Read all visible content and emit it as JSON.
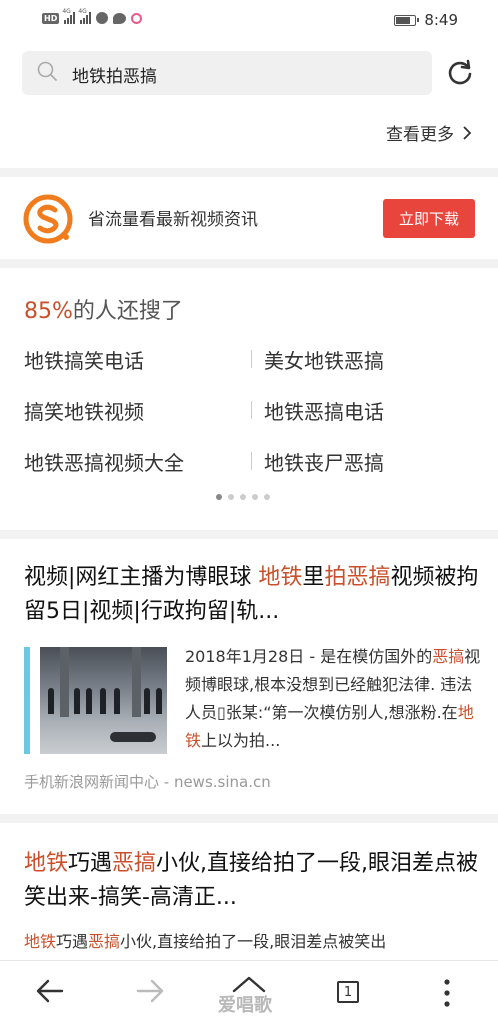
{
  "status_bar": {
    "network_badge": "HD",
    "signal1_type": "4G",
    "signal2_type": "4G",
    "time": "8:49"
  },
  "search": {
    "query": "地铁拍恶搞",
    "more_label": "查看更多"
  },
  "banner": {
    "text": "省流量看最新视频资讯",
    "button_label": "立即下载",
    "brand_color": "#f07c1e",
    "button_color": "#e8463c"
  },
  "related": {
    "title_percent": "85%",
    "title_rest": "的人还搜了",
    "items": [
      "地铁搞笑电话",
      "美女地铁恶搞",
      "搞笑地铁视频",
      "地铁恶搞电话",
      "地铁恶搞视频大全",
      "地铁丧尸恶搞"
    ],
    "page_count": 5,
    "active_page": 1
  },
  "results": [
    {
      "title_part1": "视频|网红主播为博眼球 ",
      "title_hl1": "地铁",
      "title_part2": "里",
      "title_hl2": "拍恶搞",
      "title_part3": "视频被拘留5日|视频|行政拘留|轨...",
      "snippet_part1": "2018年1月28日 - 是在模仿国外的",
      "snippet_hl1": "恶搞",
      "snippet_part2": "视频博眼球,根本没想到已经触犯法律. 违法人员",
      "snippet_glyph": "▯",
      "snippet_part3": "张某:“第一次模仿别人,想涨粉.在",
      "snippet_hl2": "地铁",
      "snippet_part4": "上以为拍...",
      "source": "手机新浪网新闻中心 - news.sina.cn"
    },
    {
      "title_hl1": "地铁",
      "title_part1": "巧遇",
      "title_hl2": "恶搞",
      "title_part2": "小伙,直接给拍了一段,眼泪差点被笑出来-搞笑-高清正...",
      "snippet_hl1": "地铁",
      "snippet_part1": "巧遇",
      "snippet_hl2": "恶搞",
      "snippet_part2": "小伙,直接给拍了一段,眼泪差点被笑出"
    }
  ],
  "bottom_nav": {
    "tab_count": "1",
    "watermark": "爱唱歌"
  },
  "colors": {
    "highlight": "#c9502b",
    "accent_blue": "#6cc7e0"
  }
}
